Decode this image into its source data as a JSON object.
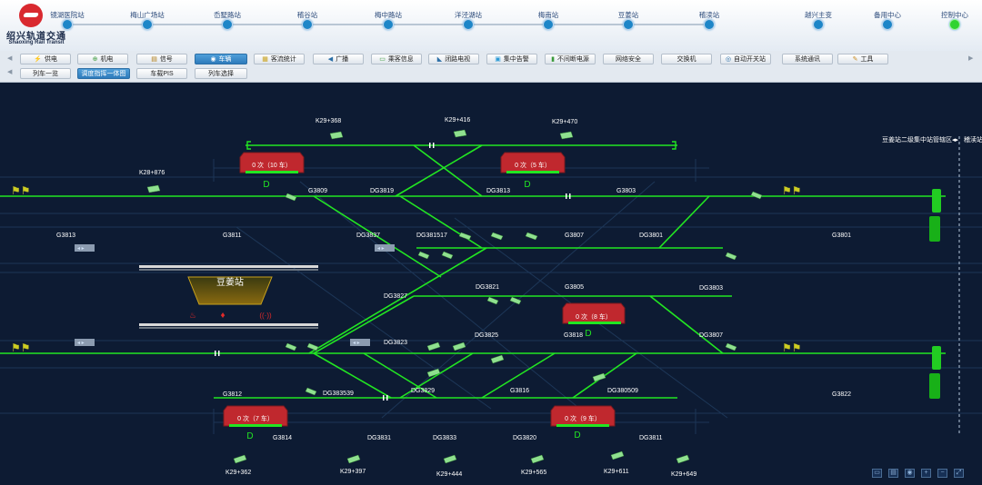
{
  "logo": {
    "cn": "绍兴轨道交通",
    "en": "Shaoxing Rail Transit"
  },
  "stations": [
    "镜湖医院站",
    "梅山广场站",
    "岙墅路站",
    "稽谷站",
    "梅中路站",
    "洋泾湖站",
    "梅南站",
    "豆姜站",
    "稽渎站"
  ],
  "right_stations": [
    "越兴主变",
    "备用中心",
    "控制中心"
  ],
  "menu": {
    "main": [
      "供电",
      "机电",
      "信号",
      "车辆",
      "客流统计",
      "广播",
      "乘客信息",
      "闭路电视",
      "集中告警",
      "不间断电源",
      "网络安全",
      "交换机",
      "自动开关站",
      "系统通讯",
      "工具"
    ],
    "active": "车辆",
    "sub": [
      "列车一览",
      "调度指挥一体图",
      "车载PIS",
      "列车选择"
    ],
    "sub_active": "调度指挥一体图"
  },
  "schematic": {
    "station_name": "豆姜站",
    "boundary_label": "豆姜站二级集中站管辖区",
    "boundary_next": "稽渎站",
    "km_posts": [
      "K29+368",
      "K29+416",
      "K29+470",
      "K28+876",
      "K29+362",
      "K29+397",
      "K29+444",
      "K29+565",
      "K29+611",
      "K29+649"
    ],
    "trains": [
      {
        "id": "t1",
        "label": "0 次（10 车）"
      },
      {
        "id": "t2",
        "label": "0 次（5 车）"
      },
      {
        "id": "t3",
        "label": "0 次（8 车）"
      },
      {
        "id": "t4",
        "label": "0 次（7 车）"
      },
      {
        "id": "t5",
        "label": "0 次（9 车）"
      }
    ],
    "sections": {
      "g3809": "G3809",
      "dg3819": "DG3819",
      "dg3813": "DG3813",
      "g3803": "G3803",
      "g3813": "G3813",
      "g3811": "G3811",
      "dg3837": "DG3837",
      "dg381517": "DG381517",
      "g3807": "G3807",
      "dg3801": "DG3801",
      "g3801": "G3801",
      "dg3821": "DG3821",
      "g3805": "G3805",
      "dg3803": "DG3803",
      "dg3827": "DG3827",
      "dg3823": "DG3823",
      "dg3825": "DG3825",
      "g3818": "G3818",
      "dg3807": "DG3807",
      "g3812": "G3812",
      "dg383539": "DG383539",
      "dg3829": "DG3829",
      "g3816": "G3816",
      "dg380509": "DG380509",
      "g3822": "G3822",
      "g3814": "G3814",
      "dg3831": "DG3831",
      "dg3833": "DG3833",
      "dg3820": "DG3820",
      "dg3811": "DG3811"
    },
    "d_marker": "D",
    "colors": {
      "track": "#22e622",
      "train": "#c0282e",
      "bg": "#0d1b33",
      "label": "#ffffff"
    }
  }
}
